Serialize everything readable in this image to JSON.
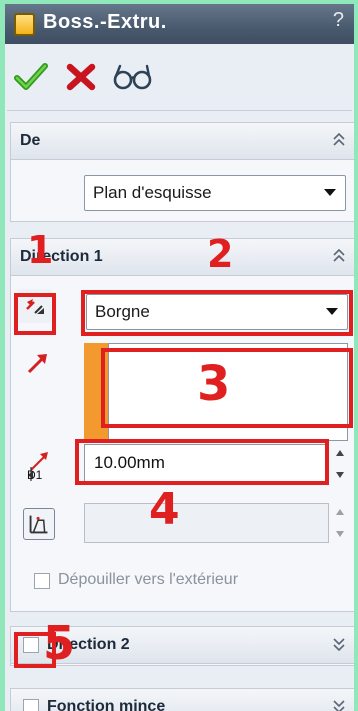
{
  "window": {
    "title": "Boss.-Extru.",
    "help_label": "?"
  },
  "toolbar": {
    "ok_icon": "checkmark-icon",
    "cancel_icon": "x-icon",
    "preview_icon": "glasses-icon"
  },
  "from_group": {
    "label": "De",
    "selected": "Plan d'esquisse"
  },
  "direction1": {
    "label": "Direction 1",
    "end_condition": "Borgne",
    "depth_value": "10.00mm",
    "depth_symbol": "D1",
    "draft_outward_label": "Dépouiller vers l'extérieur"
  },
  "direction2": {
    "label": "Direction 2",
    "checked": false
  },
  "thin_feature": {
    "label": "Fonction mince",
    "checked": false
  },
  "annotations": {
    "n1": "1",
    "n2": "2",
    "n3": "3",
    "n4": "4",
    "n5": "5"
  },
  "colors": {
    "title_bar": "#4a5a6e",
    "annotation_red": "#e02020",
    "direction_arrow": "#d62020",
    "face_orange": "#f29a2e",
    "background_green": "#8fe7ba"
  }
}
